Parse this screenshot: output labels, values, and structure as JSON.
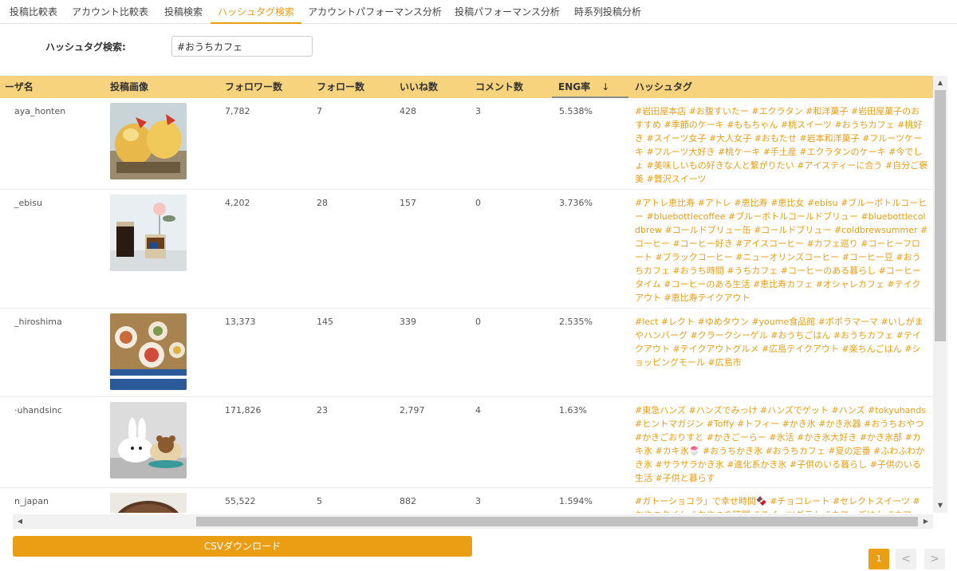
{
  "tabs": [
    {
      "label": "投稿比較表"
    },
    {
      "label": "アカウント比較表"
    },
    {
      "label": "投稿検索"
    },
    {
      "label": "ハッシュタグ検索"
    },
    {
      "label": "アカウントパフォーマンス分析"
    },
    {
      "label": "投稿パフォーマンス分析"
    },
    {
      "label": "時系列投稿分析"
    }
  ],
  "active_tab": "ハッシュタグ検索",
  "search": {
    "label": "ハッシュタグ検索:",
    "value": "#おうちカフェ"
  },
  "table": {
    "columns": [
      "ーザ名",
      "投稿画像",
      "フォロワー数",
      "フォロー数",
      "いいね数",
      "コメント数",
      "ENG率",
      "ハッシュタグ"
    ],
    "sort_column": "ENG率",
    "sort_indicator": "↓",
    "rows": [
      {
        "user": "aya_honten",
        "followers": "7,782",
        "following": "7",
        "likes": "428",
        "comments": "3",
        "eng": "5.538%",
        "hashtags": "#岩田屋本店 #お腹すいたー #エクラタン #和洋菓子 #岩田屋菓子のおすすめ #季節のケーキ #ももちゃん #桃スイーツ #おうちカフェ #桃好き #スイーツ女子 #大人女子 #おもたせ #岩本和洋菓子 #フルーツケーキ #フルーツ大好き #桃ケーキ #手土産 #エクラタンのケーキ #今でしょ #美味しいもの好きな人と繋がりたい #アイスティーに合う #自分ご褒美 #贅沢スイーツ"
      },
      {
        "user": "_ebisu",
        "followers": "4,202",
        "following": "28",
        "likes": "157",
        "comments": "0",
        "eng": "3.736%",
        "hashtags": "#アトレ恵比寿 #アトレ #恵比寿 #恵比女 #ebisu #ブルーボトルコーヒー #bluebottlecoffee #ブルーボトルコールドブリュー #bluebottlecoldbrew #コールドブリュー缶 #コールドブリュー #coldbrewsummer #コーヒー #コーヒー好き #アイスコーヒー #カフェ巡り #コーヒーフロート #ブラックコーヒー #ニューオリンズコーヒー #コーヒー豆 #おうちカフェ #おうち時間 #うちカフェ #コーヒーのある暮らし #コーヒータイム #コーヒーのある生活 #恵比寿カフェ #オシャレカフェ #テイクアウト #恵比寿テイクアウト"
      },
      {
        "user": "_hiroshima",
        "followers": "13,373",
        "following": "145",
        "likes": "339",
        "comments": "0",
        "eng": "2.535%",
        "hashtags": "#lect #レクト #ゆめタウン #youme食品館 #ポポラマーマ #いしがまやハンバーグ #クラークシーゲル #おうちごはん #おうちカフェ #テイクアウト #テイクアウトグルメ #広島テイクアウト #楽ちんごはん #ショッピングモール #広島市"
      },
      {
        "user": "·uhandsinc",
        "followers": "171,826",
        "following": "23",
        "likes": "2,797",
        "comments": "4",
        "eng": "1.63%",
        "hashtags": "#東急ハンズ #ハンズでみっけ #ハンズでゲット #ハンズ #tokyuhands #ヒントマガジン #Toffy #トフィー #かき氷 #かき氷器 #おうちおやつ #かきごおりすと #かきごーらー #氷活 #かき氷大好き #かき氷部 #カキ氷 #カキ氷🍧 #おうちかき氷 #おうちカフェ #夏の定番 #ふわふわかき氷 #サラサラかき氷 #進化系かき氷 #子供のいる暮らし #子供のいる生活 #子供と暮らす"
      },
      {
        "user": "n_japan",
        "followers": "55,522",
        "following": "5",
        "likes": "882",
        "comments": "3",
        "eng": "1.594%",
        "hashtags": "#ガトーショコラ」で幸せ時間🍫 #チョコレート #セレクトスイーツ #おやつタイム #おやつの時間 #スイーツグラム #カフェごはん #カフェ"
      }
    ]
  },
  "csv_button": "CSVダウンロード",
  "pagination": {
    "current": "1",
    "prev": "<",
    "next": ">"
  },
  "colors": {
    "accent": "#e99e14",
    "header_bg": "#f7d37e"
  }
}
